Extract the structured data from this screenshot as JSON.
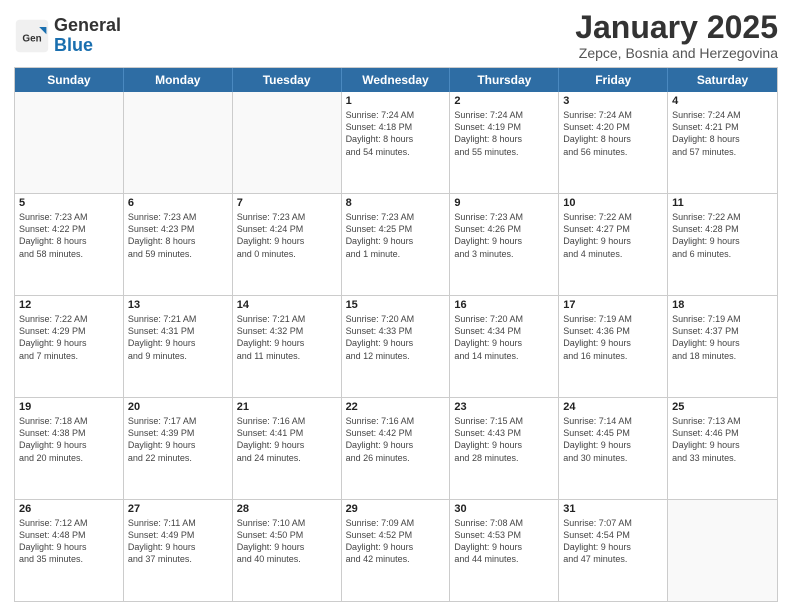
{
  "header": {
    "logo_general": "General",
    "logo_blue": "Blue",
    "month": "January 2025",
    "location": "Zepce, Bosnia and Herzegovina"
  },
  "days_of_week": [
    "Sunday",
    "Monday",
    "Tuesday",
    "Wednesday",
    "Thursday",
    "Friday",
    "Saturday"
  ],
  "weeks": [
    [
      {
        "day": "",
        "lines": []
      },
      {
        "day": "",
        "lines": []
      },
      {
        "day": "",
        "lines": []
      },
      {
        "day": "1",
        "lines": [
          "Sunrise: 7:24 AM",
          "Sunset: 4:18 PM",
          "Daylight: 8 hours",
          "and 54 minutes."
        ]
      },
      {
        "day": "2",
        "lines": [
          "Sunrise: 7:24 AM",
          "Sunset: 4:19 PM",
          "Daylight: 8 hours",
          "and 55 minutes."
        ]
      },
      {
        "day": "3",
        "lines": [
          "Sunrise: 7:24 AM",
          "Sunset: 4:20 PM",
          "Daylight: 8 hours",
          "and 56 minutes."
        ]
      },
      {
        "day": "4",
        "lines": [
          "Sunrise: 7:24 AM",
          "Sunset: 4:21 PM",
          "Daylight: 8 hours",
          "and 57 minutes."
        ]
      }
    ],
    [
      {
        "day": "5",
        "lines": [
          "Sunrise: 7:23 AM",
          "Sunset: 4:22 PM",
          "Daylight: 8 hours",
          "and 58 minutes."
        ]
      },
      {
        "day": "6",
        "lines": [
          "Sunrise: 7:23 AM",
          "Sunset: 4:23 PM",
          "Daylight: 8 hours",
          "and 59 minutes."
        ]
      },
      {
        "day": "7",
        "lines": [
          "Sunrise: 7:23 AM",
          "Sunset: 4:24 PM",
          "Daylight: 9 hours",
          "and 0 minutes."
        ]
      },
      {
        "day": "8",
        "lines": [
          "Sunrise: 7:23 AM",
          "Sunset: 4:25 PM",
          "Daylight: 9 hours",
          "and 1 minute."
        ]
      },
      {
        "day": "9",
        "lines": [
          "Sunrise: 7:23 AM",
          "Sunset: 4:26 PM",
          "Daylight: 9 hours",
          "and 3 minutes."
        ]
      },
      {
        "day": "10",
        "lines": [
          "Sunrise: 7:22 AM",
          "Sunset: 4:27 PM",
          "Daylight: 9 hours",
          "and 4 minutes."
        ]
      },
      {
        "day": "11",
        "lines": [
          "Sunrise: 7:22 AM",
          "Sunset: 4:28 PM",
          "Daylight: 9 hours",
          "and 6 minutes."
        ]
      }
    ],
    [
      {
        "day": "12",
        "lines": [
          "Sunrise: 7:22 AM",
          "Sunset: 4:29 PM",
          "Daylight: 9 hours",
          "and 7 minutes."
        ]
      },
      {
        "day": "13",
        "lines": [
          "Sunrise: 7:21 AM",
          "Sunset: 4:31 PM",
          "Daylight: 9 hours",
          "and 9 minutes."
        ]
      },
      {
        "day": "14",
        "lines": [
          "Sunrise: 7:21 AM",
          "Sunset: 4:32 PM",
          "Daylight: 9 hours",
          "and 11 minutes."
        ]
      },
      {
        "day": "15",
        "lines": [
          "Sunrise: 7:20 AM",
          "Sunset: 4:33 PM",
          "Daylight: 9 hours",
          "and 12 minutes."
        ]
      },
      {
        "day": "16",
        "lines": [
          "Sunrise: 7:20 AM",
          "Sunset: 4:34 PM",
          "Daylight: 9 hours",
          "and 14 minutes."
        ]
      },
      {
        "day": "17",
        "lines": [
          "Sunrise: 7:19 AM",
          "Sunset: 4:36 PM",
          "Daylight: 9 hours",
          "and 16 minutes."
        ]
      },
      {
        "day": "18",
        "lines": [
          "Sunrise: 7:19 AM",
          "Sunset: 4:37 PM",
          "Daylight: 9 hours",
          "and 18 minutes."
        ]
      }
    ],
    [
      {
        "day": "19",
        "lines": [
          "Sunrise: 7:18 AM",
          "Sunset: 4:38 PM",
          "Daylight: 9 hours",
          "and 20 minutes."
        ]
      },
      {
        "day": "20",
        "lines": [
          "Sunrise: 7:17 AM",
          "Sunset: 4:39 PM",
          "Daylight: 9 hours",
          "and 22 minutes."
        ]
      },
      {
        "day": "21",
        "lines": [
          "Sunrise: 7:16 AM",
          "Sunset: 4:41 PM",
          "Daylight: 9 hours",
          "and 24 minutes."
        ]
      },
      {
        "day": "22",
        "lines": [
          "Sunrise: 7:16 AM",
          "Sunset: 4:42 PM",
          "Daylight: 9 hours",
          "and 26 minutes."
        ]
      },
      {
        "day": "23",
        "lines": [
          "Sunrise: 7:15 AM",
          "Sunset: 4:43 PM",
          "Daylight: 9 hours",
          "and 28 minutes."
        ]
      },
      {
        "day": "24",
        "lines": [
          "Sunrise: 7:14 AM",
          "Sunset: 4:45 PM",
          "Daylight: 9 hours",
          "and 30 minutes."
        ]
      },
      {
        "day": "25",
        "lines": [
          "Sunrise: 7:13 AM",
          "Sunset: 4:46 PM",
          "Daylight: 9 hours",
          "and 33 minutes."
        ]
      }
    ],
    [
      {
        "day": "26",
        "lines": [
          "Sunrise: 7:12 AM",
          "Sunset: 4:48 PM",
          "Daylight: 9 hours",
          "and 35 minutes."
        ]
      },
      {
        "day": "27",
        "lines": [
          "Sunrise: 7:11 AM",
          "Sunset: 4:49 PM",
          "Daylight: 9 hours",
          "and 37 minutes."
        ]
      },
      {
        "day": "28",
        "lines": [
          "Sunrise: 7:10 AM",
          "Sunset: 4:50 PM",
          "Daylight: 9 hours",
          "and 40 minutes."
        ]
      },
      {
        "day": "29",
        "lines": [
          "Sunrise: 7:09 AM",
          "Sunset: 4:52 PM",
          "Daylight: 9 hours",
          "and 42 minutes."
        ]
      },
      {
        "day": "30",
        "lines": [
          "Sunrise: 7:08 AM",
          "Sunset: 4:53 PM",
          "Daylight: 9 hours",
          "and 44 minutes."
        ]
      },
      {
        "day": "31",
        "lines": [
          "Sunrise: 7:07 AM",
          "Sunset: 4:54 PM",
          "Daylight: 9 hours",
          "and 47 minutes."
        ]
      },
      {
        "day": "",
        "lines": []
      }
    ]
  ]
}
